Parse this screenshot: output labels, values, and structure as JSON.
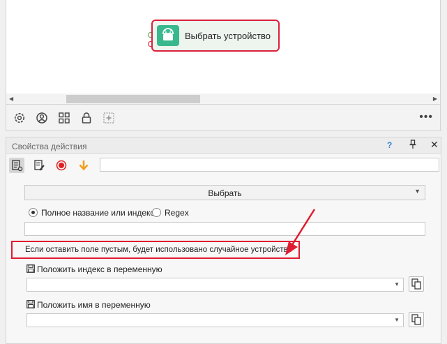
{
  "node": {
    "title": "Выбрать устройство",
    "icon": "android-icon"
  },
  "canvas_toolbar": {
    "icons": [
      "settings-gear-icon",
      "user-circle-icon",
      "grid-icon",
      "lock-icon",
      "add-block-icon"
    ],
    "more": "•••"
  },
  "panel": {
    "title": "Свойства действия",
    "help": "?",
    "close": "✕"
  },
  "action_toolbar": {
    "icons": [
      "properties-icon",
      "edit-icon",
      "record-icon",
      "download-arrow-icon"
    ],
    "search_value": ""
  },
  "form": {
    "select_value": "Выбрать",
    "radio_full_label": "Полное название или индекс:",
    "radio_regex_label": "Regex",
    "selected_radio": "full",
    "name_value": "",
    "hint": "Если оставить поле пустым, будет использовано случайное устройство",
    "save_index_label": "Положить индекс в переменную",
    "save_index_value": "",
    "save_name_label": "Положить имя в переменную",
    "save_name_value": ""
  },
  "colors": {
    "highlight": "#e01b2f",
    "node_icon_bg": "#39b88e",
    "record": "#e02020",
    "download": "#f0a020"
  }
}
